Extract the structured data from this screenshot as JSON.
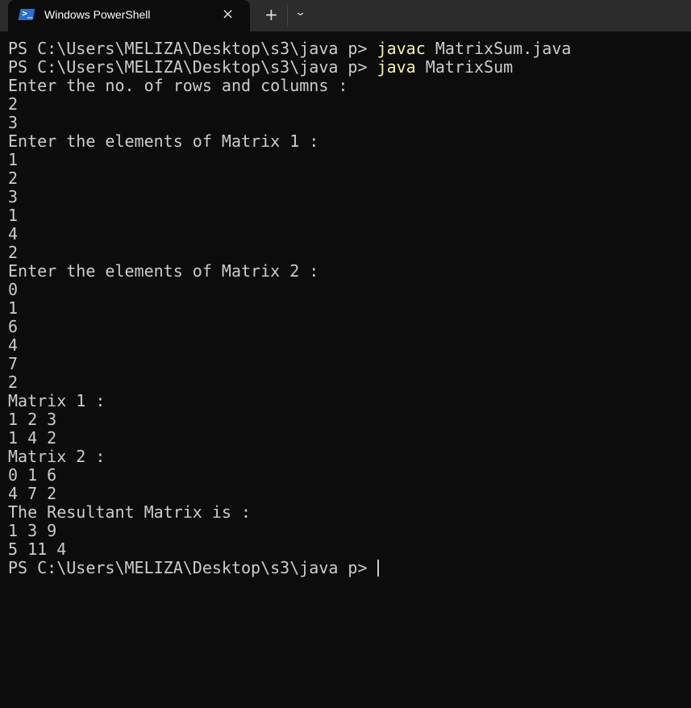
{
  "window": {
    "tab_title": "Windows PowerShell",
    "tab_icon": "powershell-icon",
    "close_icon": "×",
    "new_tab_icon": "+",
    "dropdown_icon": "⌄"
  },
  "colors": {
    "background": "#0c0c0c",
    "text": "#cccccc",
    "command": "#f9f1a5",
    "tabbar": "#2c2c2c"
  },
  "terminal": {
    "lines": [
      {
        "prompt": "PS C:\\Users\\MELIZA\\Desktop\\s3\\java p> ",
        "cmd": "javac",
        "args": " MatrixSum.java"
      },
      {
        "prompt": "PS C:\\Users\\MELIZA\\Desktop\\s3\\java p> ",
        "cmd": "java",
        "args": " MatrixSum"
      },
      {
        "text": "Enter the no. of rows and columns :"
      },
      {
        "text": "2"
      },
      {
        "text": "3"
      },
      {
        "text": "Enter the elements of Matrix 1 :"
      },
      {
        "text": "1"
      },
      {
        "text": "2"
      },
      {
        "text": "3"
      },
      {
        "text": "1"
      },
      {
        "text": "4"
      },
      {
        "text": "2"
      },
      {
        "text": "Enter the elements of Matrix 2 :"
      },
      {
        "text": "0"
      },
      {
        "text": "1"
      },
      {
        "text": "6"
      },
      {
        "text": "4"
      },
      {
        "text": "7"
      },
      {
        "text": "2"
      },
      {
        "text": "Matrix 1 :"
      },
      {
        "text": "1 2 3"
      },
      {
        "text": "1 4 2"
      },
      {
        "text": "Matrix 2 :"
      },
      {
        "text": "0 1 6"
      },
      {
        "text": "4 7 2"
      },
      {
        "text": "The Resultant Matrix is :"
      },
      {
        "text": "1 3 9"
      },
      {
        "text": "5 11 4"
      },
      {
        "prompt": "PS C:\\Users\\MELIZA\\Desktop\\s3\\java p> ",
        "cursor": true
      }
    ]
  }
}
